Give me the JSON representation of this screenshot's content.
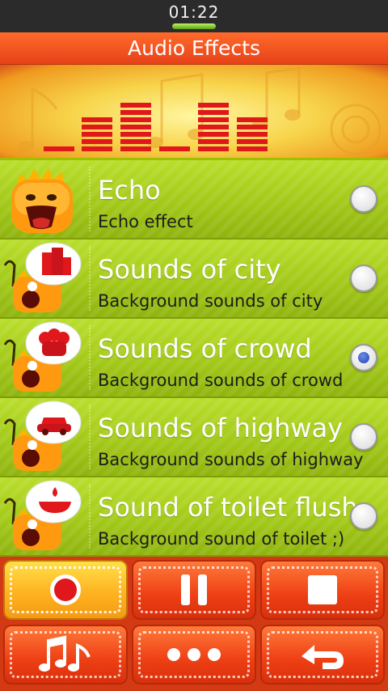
{
  "status_bar": {
    "time": "01:22"
  },
  "header": {
    "title": "Audio Effects"
  },
  "effects": [
    {
      "title": "Echo",
      "subtitle": "Echo effect",
      "icon": "orange-monster-icon",
      "selected": false
    },
    {
      "title": "Sounds of city",
      "subtitle": "Background sounds of city",
      "icon": "city-buildings-icon",
      "selected": false
    },
    {
      "title": "Sounds of crowd",
      "subtitle": "Background sounds of crowd",
      "icon": "crowd-people-icon",
      "selected": true
    },
    {
      "title": "Sounds of highway",
      "subtitle": "Background sounds of highway",
      "icon": "car-icon",
      "selected": false
    },
    {
      "title": "Sound of toilet flush",
      "subtitle": "Background sound of toilet ;)",
      "icon": "bathtub-icon",
      "selected": false
    }
  ],
  "controls": {
    "row1": [
      "record-icon",
      "pause-icon",
      "stop-icon"
    ],
    "row2": [
      "music-notes-icon",
      "more-dots-icon",
      "back-arrow-icon"
    ]
  },
  "colors": {
    "accent_red": "#e7421a",
    "list_green": "#a5cb1a",
    "active_button": "#ffb321",
    "radio_selected": "#2040b0"
  }
}
